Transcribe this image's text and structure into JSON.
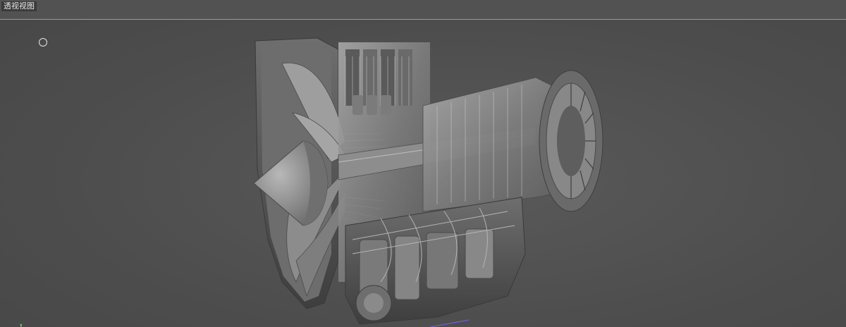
{
  "viewport": {
    "title": "透视视图"
  },
  "colors": {
    "background": "#4f4f4f",
    "header_line": "#9a9a9a",
    "model": "#8a8a8a"
  },
  "icons": {
    "pivot": "pivot-circle-icon",
    "axis": "axis-gizmo-icon"
  }
}
